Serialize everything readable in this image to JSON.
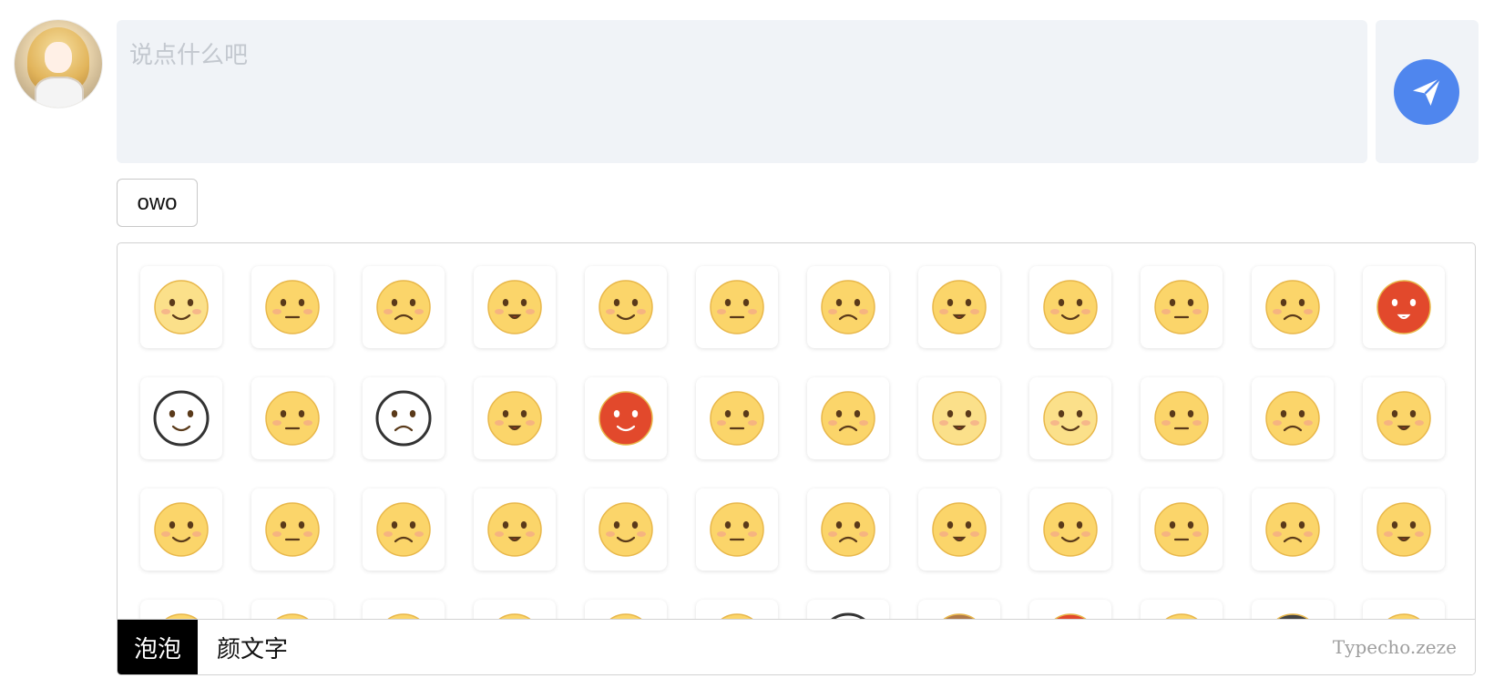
{
  "comment_box": {
    "placeholder": "说点什么吧"
  },
  "send_button": {
    "icon": "paper-plane-icon",
    "color": "#4f86ee"
  },
  "owo_toggle": {
    "label": "owo"
  },
  "emoji_panel": {
    "tabs": [
      {
        "label": "泡泡",
        "active": true
      },
      {
        "label": "颜文字",
        "active": false
      }
    ],
    "brand": "Typecho.zeze",
    "emoji_cells": [
      {
        "icon": "doge-hat-emoji-icon",
        "skin": "#fbe08a"
      },
      {
        "icon": "blushing-hand-emoji-icon",
        "skin": "#fbd56a"
      },
      {
        "icon": "dizzy-emoji-icon",
        "skin": "#fbd56a"
      },
      {
        "icon": "whistling-emoji-icon",
        "skin": "#fbd56a"
      },
      {
        "icon": "crying-tissue-emoji-icon",
        "skin": "#fbd56a"
      },
      {
        "icon": "annoyed-emoji-icon",
        "skin": "#fbd56a"
      },
      {
        "icon": "smirk-emoji-icon",
        "skin": "#fbd56a"
      },
      {
        "icon": "eating-watermelon-emoji-icon",
        "skin": "#fbd56a"
      },
      {
        "icon": "hand-over-mouth-emoji-icon",
        "skin": "#fbd56a"
      },
      {
        "icon": "grinning-teeth-emoji-icon",
        "skin": "#fbd56a"
      },
      {
        "icon": "loud-crying-emoji-icon",
        "skin": "#fbd56a"
      },
      {
        "icon": "angry-red-emoji-icon",
        "skin": "#e2492c"
      },
      {
        "icon": "husky-emoji-icon",
        "skin": "#ffffff"
      },
      {
        "icon": "side-eye-smile-emoji-icon",
        "skin": "#fbd56a"
      },
      {
        "icon": "husky-tongue-emoji-icon",
        "skin": "#ffffff"
      },
      {
        "icon": "sweat-drop-emoji-icon",
        "skin": "#fbd56a"
      },
      {
        "icon": "furious-fire-emoji-icon",
        "skin": "#e2492c"
      },
      {
        "icon": "speechless-emoji-icon",
        "skin": "#fbd56a"
      },
      {
        "icon": "yawning-emoji-icon",
        "skin": "#fbd56a"
      },
      {
        "icon": "doge-emoji-icon",
        "skin": "#fbe08a"
      },
      {
        "icon": "doge-crying-emoji-icon",
        "skin": "#fbe08a"
      },
      {
        "icon": "happy-emoji-icon",
        "skin": "#fbd56a"
      },
      {
        "icon": "pouting-emoji-icon",
        "skin": "#fbd56a"
      },
      {
        "icon": "awkward-sweat-emoji-icon",
        "skin": "#fbd56a"
      },
      {
        "icon": "nosebleed-emoji-icon",
        "skin": "#fbd56a"
      },
      {
        "icon": "shy-sly-emoji-icon",
        "skin": "#fbd56a"
      },
      {
        "icon": "unimpressed-emoji-icon",
        "skin": "#fbd56a"
      },
      {
        "icon": "thinking-emoji-icon",
        "skin": "#fbd56a"
      },
      {
        "icon": "wry-smile-emoji-icon",
        "skin": "#fbd56a"
      },
      {
        "icon": "big-grin-emoji-icon",
        "skin": "#fbd56a"
      },
      {
        "icon": "laughing-emoji-icon",
        "skin": "#fbd56a"
      },
      {
        "icon": "doubtful-emoji-icon",
        "skin": "#fbd56a"
      },
      {
        "icon": "shocked-emoji-icon",
        "skin": "#fbd56a"
      },
      {
        "icon": "pain-emoji-icon",
        "skin": "#fbd56a"
      },
      {
        "icon": "wink-tongue-emoji-icon",
        "skin": "#fbd56a"
      },
      {
        "icon": "laughing-tears-emoji-icon",
        "skin": "#fbd56a"
      },
      {
        "icon": "partial-emoji-icon",
        "skin": "#fbd56a"
      },
      {
        "icon": "partial-emoji-icon",
        "skin": "#fbd56a"
      },
      {
        "icon": "partial-emoji-icon",
        "skin": "#fbd56a"
      },
      {
        "icon": "partial-emoji-icon",
        "skin": "#fbd56a"
      },
      {
        "icon": "partial-emoji-icon",
        "skin": "#fbd56a"
      },
      {
        "icon": "partial-emoji-icon",
        "skin": "#fbd56a"
      },
      {
        "icon": "partial-emoji-icon",
        "skin": "#ffffff"
      },
      {
        "icon": "partial-emoji-icon",
        "skin": "#b07a4a"
      },
      {
        "icon": "partial-emoji-icon",
        "skin": "#e2492c"
      },
      {
        "icon": "partial-emoji-icon",
        "skin": "#fbd56a"
      },
      {
        "icon": "partial-emoji-icon",
        "skin": "#444444"
      },
      {
        "icon": "partial-emoji-icon",
        "skin": "#fbd56a"
      }
    ]
  }
}
